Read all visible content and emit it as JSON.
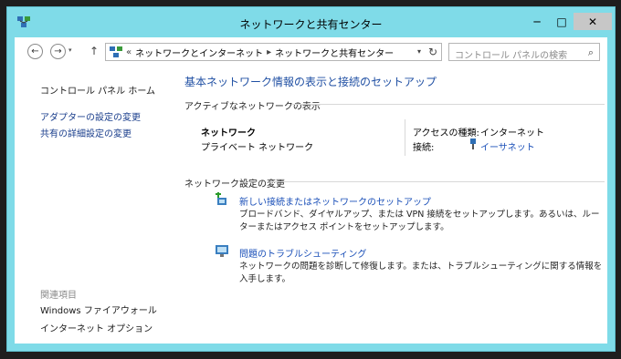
{
  "window": {
    "title": "ネットワークと共有センター",
    "buttons": {
      "minimize": "─",
      "maximize": "□",
      "close": "✕"
    }
  },
  "nav": {
    "back": "←",
    "forward": "→",
    "dropdown": "▾",
    "up": "↑",
    "overflow": "«",
    "breadcrumbs": [
      "ネットワークとインターネット",
      "ネットワークと共有センター"
    ],
    "crumb_separator": "▸",
    "address_dropdown": "▾",
    "refresh": "↻",
    "search_placeholder": "コントロール パネルの検索",
    "search_icon": "⌕"
  },
  "sidebar": {
    "home": "コントロール パネル ホーム",
    "links": [
      "アダプターの設定の変更",
      "共有の詳細設定の変更"
    ],
    "see_also_heading": "関連項目",
    "see_also": [
      "Windows ファイアウォール",
      "インターネット オプション"
    ]
  },
  "main": {
    "title": "基本ネットワーク情報の表示と接続のセットアップ",
    "active_heading": "アクティブなネットワークの表示",
    "network": {
      "name": "ネットワーク",
      "category": "プライベート ネットワーク",
      "access_label": "アクセスの種類:",
      "access_value": "インターネット",
      "connection_label": "接続:",
      "connection_value": "イーサネット"
    },
    "change_heading": "ネットワーク設定の変更",
    "tasks": [
      {
        "link": "新しい接続またはネットワークのセットアップ",
        "desc": "ブロードバンド、ダイヤルアップ、または VPN 接続をセットアップします。あるいは、ルーターまたはアクセス ポイントをセットアップします。"
      },
      {
        "link": "問題のトラブルシューティング",
        "desc": "ネットワークの問題を診断して修復します。または、トラブルシューティングに関する情報を入手します。"
      }
    ]
  }
}
